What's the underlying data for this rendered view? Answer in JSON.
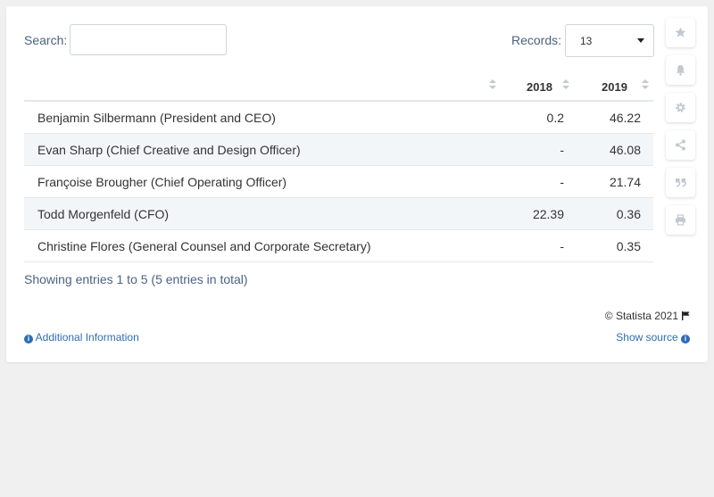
{
  "search": {
    "label": "Search:",
    "value": ""
  },
  "records": {
    "label": "Records:",
    "selected": "13"
  },
  "table": {
    "columns": [
      "",
      "2018",
      "2019"
    ],
    "rows": [
      {
        "name": "Benjamin Silbermann (President and CEO)",
        "v2018": "0.2",
        "v2019": "46.22"
      },
      {
        "name": "Evan Sharp (Chief Creative and Design Officer)",
        "v2018": "-",
        "v2019": "46.08"
      },
      {
        "name": "Françoise Brougher (Chief Operating Officer)",
        "v2018": "-",
        "v2019": "21.74"
      },
      {
        "name": "Todd Morgenfeld (CFO)",
        "v2018": "22.39",
        "v2019": "0.36"
      },
      {
        "name": "Christine Flores (General Counsel and Corporate Secretary)",
        "v2018": "-",
        "v2019": "0.35"
      }
    ]
  },
  "footer": {
    "showing": "Showing entries 1 to 5 (5 entries in total)",
    "copyright": "© Statista 2021",
    "additional_info": "Additional Information",
    "show_source": "Show source"
  },
  "sidebar": {
    "icons": [
      "star-icon",
      "bell-icon",
      "gear-icon",
      "share-icon",
      "quote-icon",
      "print-icon"
    ]
  },
  "colors": {
    "link": "#2e6db4",
    "label": "#4a6282",
    "icon": "#c2c8d0"
  }
}
